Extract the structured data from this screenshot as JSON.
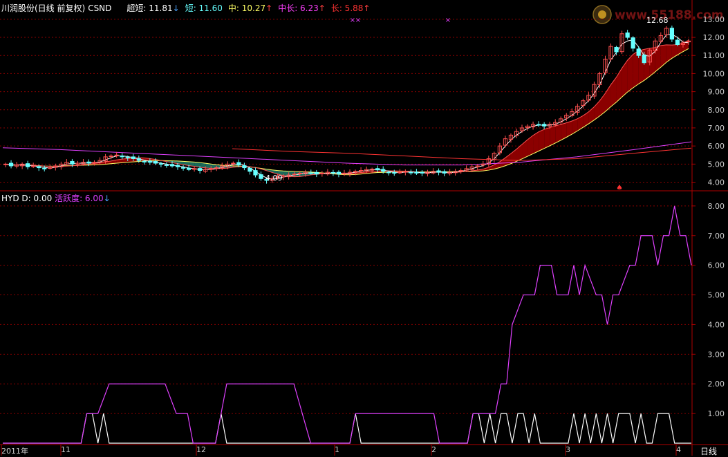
{
  "upper_panel": {
    "stock_name": "川润股份(日线 前复权)",
    "code": "CSND",
    "indicators": [
      {
        "label": "超短:",
        "value": "11.81",
        "arrow": "↓",
        "color": "#ffffff",
        "arrow_color": "#4aa3ff"
      },
      {
        "label": "短:",
        "value": "11.60",
        "arrow": "",
        "color": "#66ffff",
        "arrow_color": ""
      },
      {
        "label": "中:",
        "value": "10.27",
        "arrow": "↑",
        "color": "#ffff66",
        "arrow_color": "#ff4040"
      },
      {
        "label": "中长:",
        "value": "6.23",
        "arrow": "↑",
        "color": "#ff40ff",
        "arrow_color": "#ff4040"
      },
      {
        "label": "长:",
        "value": "5.88",
        "arrow": "↑",
        "color": "#ff3333",
        "arrow_color": "#ff4040"
      }
    ],
    "y_ticks": [
      "13.00",
      "12.00",
      "11.00",
      "10.00",
      "9.00",
      "8.00",
      "7.00",
      "6.00",
      "5.00",
      "4.00"
    ],
    "low_marker": "4.09",
    "high_marker": "12.68"
  },
  "lower_panel": {
    "label_hyd": "HYD",
    "label_d": "D: 0.00",
    "label_activity": "活跃度: 6.00",
    "activity_arrow": "↓",
    "y_ticks": [
      "8.00",
      "7.00",
      "6.00",
      "5.00",
      "4.00",
      "3.00",
      "2.00",
      "1.00"
    ]
  },
  "x_axis": {
    "labels": [
      "2011年",
      "11",
      "12",
      "1",
      "2",
      "3",
      "4"
    ],
    "period": "日线"
  },
  "logo": {
    "text": "www.55188.com",
    "text_short": "www.55188.com"
  },
  "colors": {
    "background": "#000000",
    "grid": "#8b0000",
    "axis": "#b00000",
    "activity_line": "#e040ff",
    "d_line": "#ffffff",
    "up_candle": "#ff5050",
    "down_candle": "#66ffff",
    "band_up": "#8b0000",
    "band_down": "#1a6a5a"
  },
  "chart_data": [
    {
      "type": "line",
      "title": "",
      "series": [
        {
          "name": "活跃度",
          "values": [
            0,
            0,
            0,
            0,
            0,
            0,
            0,
            0,
            0,
            0,
            0,
            0,
            0,
            0,
            0,
            0,
            0,
            0,
            0,
            0,
            0,
            0,
            0,
            0,
            0,
            0,
            0,
            0,
            0,
            0,
            0,
            0,
            0,
            0,
            0,
            0,
            0,
            0,
            0,
            0,
            0,
            0,
            0,
            0,
            0,
            0,
            0,
            0,
            0,
            0,
            0,
            0,
            0,
            0,
            0,
            0,
            0,
            0,
            0,
            0,
            0,
            0,
            0,
            0,
            0,
            0,
            0,
            0,
            0,
            0,
            0,
            0,
            0,
            0,
            0,
            0,
            0,
            0,
            0,
            0,
            0,
            0,
            0,
            0,
            0,
            0,
            0,
            0,
            0,
            0,
            0,
            0,
            0,
            0,
            0,
            0,
            0,
            0,
            0,
            0,
            0,
            0,
            0,
            0,
            0,
            0,
            0,
            0,
            0,
            0,
            0,
            0,
            0,
            0,
            0,
            0,
            0,
            0,
            0,
            0,
            0,
            0,
            0,
            0,
            0,
            0,
            0,
            0,
            0,
            0,
            0,
            0,
            0,
            0,
            0,
            0,
            0,
            0,
            0,
            0,
            0,
            0,
            0,
            0,
            0,
            0,
            0,
            0,
            0,
            0,
            0,
            0,
            0,
            0,
            0,
            0,
            0,
            0,
            0,
            0,
            0,
            0,
            0,
            0,
            0,
            0,
            0,
            0,
            0,
            0,
            0,
            0,
            0,
            0,
            0,
            0,
            0,
            0,
            0,
            0,
            0,
            0,
            0,
            0,
            0,
            0,
            0,
            0,
            0,
            0,
            0,
            0,
            0,
            0,
            0,
            0,
            0,
            0,
            0,
            0,
            0,
            0,
            0,
            0,
            0,
            0,
            0,
            0,
            0,
            0,
            0,
            0,
            0,
            0,
            0,
            0,
            0,
            0,
            0,
            0,
            0,
            0,
            0,
            0,
            0,
            0,
            0,
            0,
            0,
            0,
            0,
            0,
            0,
            0,
            0,
            0,
            0,
            0,
            0,
            0,
            0,
            0,
            0,
            0,
            0,
            0,
            0,
            0,
            0,
            0,
            0,
            0,
            0,
            0,
            0,
            0,
            0,
            0,
            0,
            0,
            0,
            0,
            0,
            0,
            0,
            0,
            0,
            0,
            0,
            0,
            0,
            0,
            0,
            0,
            0,
            0,
            0,
            0,
            0,
            0,
            0,
            0,
            0,
            0,
            0,
            0,
            0,
            0,
            0,
            0,
            0,
            0,
            0,
            0,
            0,
            0,
            0,
            0,
            0,
            0,
            0,
            0,
            0,
            0,
            0,
            0,
            0,
            0,
            0,
            0,
            0,
            0,
            0,
            0,
            0
          ]
        },
        {
          "name": "D",
          "values": []
        }
      ],
      "activity_points": [
        [
          0,
          0
        ],
        [
          14,
          0
        ],
        [
          15,
          1
        ],
        [
          17,
          1
        ],
        [
          19,
          2
        ],
        [
          29,
          2
        ],
        [
          31,
          1
        ],
        [
          33,
          1
        ],
        [
          34,
          0
        ],
        [
          38,
          0
        ],
        [
          40,
          2
        ],
        [
          52,
          2
        ],
        [
          55,
          0
        ],
        [
          62,
          0
        ],
        [
          63,
          1
        ],
        [
          77,
          1
        ],
        [
          78,
          0
        ],
        [
          83,
          0
        ],
        [
          84,
          1
        ],
        [
          88,
          1
        ],
        [
          89,
          2
        ],
        [
          90,
          2
        ],
        [
          91,
          4
        ],
        [
          93,
          5
        ],
        [
          95,
          5
        ],
        [
          96,
          6
        ],
        [
          98,
          6
        ],
        [
          99,
          5
        ],
        [
          101,
          5
        ],
        [
          102,
          6
        ],
        [
          103,
          5
        ],
        [
          104,
          6
        ],
        [
          106,
          5
        ],
        [
          107,
          5
        ],
        [
          108,
          4
        ],
        [
          109,
          5
        ],
        [
          110,
          5
        ],
        [
          112,
          6
        ],
        [
          113,
          6
        ],
        [
          114,
          7
        ],
        [
          116,
          7
        ],
        [
          117,
          6
        ],
        [
          118,
          7
        ],
        [
          119,
          7
        ],
        [
          120,
          8
        ],
        [
          121,
          7
        ],
        [
          122,
          7
        ],
        [
          123,
          6
        ]
      ],
      "d_points": [
        [
          0,
          0
        ],
        [
          14,
          0
        ],
        [
          15,
          1
        ],
        [
          16,
          1
        ],
        [
          17,
          0
        ],
        [
          18,
          1
        ],
        [
          19,
          0
        ],
        [
          33,
          0
        ],
        [
          34,
          0
        ],
        [
          38,
          0
        ],
        [
          39,
          1
        ],
        [
          40,
          0
        ],
        [
          62,
          0
        ],
        [
          63,
          1
        ],
        [
          64,
          0
        ],
        [
          83,
          0
        ],
        [
          84,
          1
        ],
        [
          85,
          1
        ],
        [
          86,
          0
        ],
        [
          87,
          1
        ],
        [
          88,
          0
        ],
        [
          89,
          1
        ],
        [
          90,
          1
        ],
        [
          91,
          0
        ],
        [
          92,
          1
        ],
        [
          93,
          1
        ],
        [
          94,
          0
        ],
        [
          95,
          1
        ],
        [
          96,
          0
        ],
        [
          101,
          0
        ],
        [
          102,
          1
        ],
        [
          103,
          0
        ],
        [
          104,
          1
        ],
        [
          105,
          0
        ],
        [
          106,
          1
        ],
        [
          107,
          0
        ],
        [
          108,
          1
        ],
        [
          109,
          0
        ],
        [
          110,
          1
        ],
        [
          111,
          1
        ],
        [
          112,
          1
        ],
        [
          113,
          0
        ],
        [
          114,
          1
        ],
        [
          115,
          0
        ],
        [
          116,
          0
        ],
        [
          117,
          1
        ],
        [
          118,
          1
        ],
        [
          119,
          1
        ],
        [
          120,
          0
        ],
        [
          121,
          0
        ],
        [
          122,
          0
        ],
        [
          123,
          0
        ]
      ],
      "x_count": 124,
      "ylim": [
        0,
        8.3
      ],
      "y_ticks": [
        1,
        2,
        3,
        4,
        5,
        6,
        7,
        8
      ],
      "grid": true
    },
    {
      "type": "line",
      "title": "",
      "price_close": [
        5.0,
        4.9,
        4.95,
        5.0,
        4.85,
        4.9,
        4.8,
        4.75,
        4.8,
        4.9,
        5.0,
        5.1,
        5.0,
        5.05,
        5.1,
        5.05,
        5.1,
        5.2,
        5.4,
        5.45,
        5.5,
        5.4,
        5.35,
        5.3,
        5.2,
        5.15,
        5.1,
        5.05,
        5.0,
        4.95,
        4.9,
        4.85,
        4.8,
        4.7,
        4.75,
        4.65,
        4.7,
        4.75,
        4.8,
        4.9,
        5.0,
        5.05,
        4.95,
        4.8,
        4.6,
        4.4,
        4.2,
        4.1,
        4.2,
        4.3,
        4.35,
        4.4,
        4.45,
        4.5,
        4.55,
        4.5,
        4.45,
        4.5,
        4.55,
        4.5,
        4.45,
        4.5,
        4.55,
        4.6,
        4.65,
        4.7,
        4.72,
        4.68,
        4.6,
        4.55,
        4.5,
        4.55,
        4.6,
        4.55,
        4.5,
        4.5,
        4.55,
        4.6,
        4.55,
        4.5,
        4.55,
        4.6,
        4.65,
        4.75,
        4.85,
        4.9,
        5.0,
        5.3,
        5.6,
        6.0,
        6.4,
        6.6,
        6.8,
        7.0,
        7.1,
        7.2,
        7.15,
        7.1,
        7.2,
        7.3,
        7.5,
        7.7,
        7.9,
        8.2,
        8.5,
        8.8,
        9.4,
        10.0,
        10.8,
        11.5,
        11.2,
        12.2,
        12.0,
        11.4,
        11.0,
        10.6,
        11.3,
        11.8,
        12.1,
        12.5,
        11.9,
        11.6,
        11.7,
        11.8
      ],
      "ylim": [
        3.6,
        13.3
      ],
      "y_ticks": [
        4,
        5,
        6,
        7,
        8,
        9,
        10,
        11,
        12,
        13
      ],
      "grid": true
    }
  ]
}
